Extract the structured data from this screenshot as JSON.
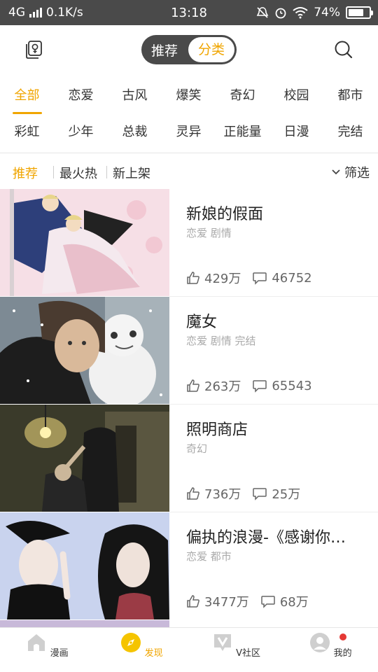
{
  "status_bar": {
    "network": "4G",
    "speed": "0.1K/s",
    "time": "13:18",
    "battery": "74%",
    "battery_level": 0.74
  },
  "top_nav": {
    "segment_left": "推荐",
    "segment_right": "分类"
  },
  "categories": {
    "row1": [
      "全部",
      "恋爱",
      "古风",
      "爆笑",
      "奇幻",
      "校园",
      "都市"
    ],
    "row2": [
      "彩虹",
      "少年",
      "总裁",
      "灵异",
      "正能量",
      "日漫",
      "完结"
    ],
    "active": "全部"
  },
  "filter": {
    "tabs": [
      "推荐",
      "最火热",
      "新上架"
    ],
    "active": "推荐",
    "filter_label": "筛选"
  },
  "list": [
    {
      "title": "新娘的假面",
      "tags": "恋爱 剧情",
      "likes": "429万",
      "comments": "46752"
    },
    {
      "title": "魔女",
      "tags": "恋爱 剧情 完结",
      "likes": "263万",
      "comments": "65543"
    },
    {
      "title": "照明商店",
      "tags": "奇幻",
      "likes": "736万",
      "comments": "25万"
    },
    {
      "title": "偏执的浪漫-《感谢你…",
      "tags": "恋爱 都市",
      "likes": "3477万",
      "comments": "68万"
    }
  ],
  "bottom_nav": {
    "items": [
      "漫画",
      "发现",
      "V社区",
      "我的"
    ],
    "active": "发现"
  },
  "colors": {
    "accent": "#f0a500",
    "dark": "#4a4a4a",
    "badge": "#e53935"
  }
}
